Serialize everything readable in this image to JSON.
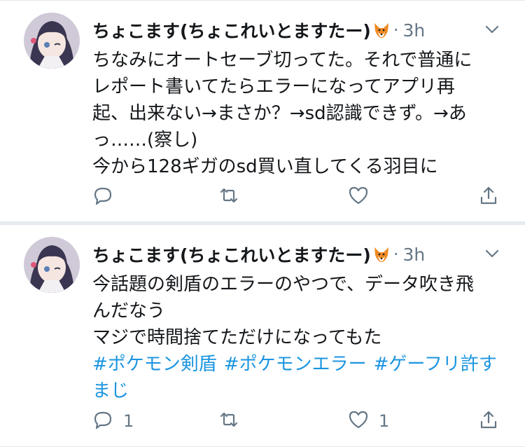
{
  "tweets": [
    {
      "author": "ちょこます(ちょこれいとますたー)",
      "separator": "·",
      "time": "3h",
      "lines": [
        "ちなみにオートセーブ切ってた。それで普通に",
        "レポート書いてたらエラーになってアプリ再",
        "起、出来ない→まさか？→sd認識できず。→あ",
        "っ……(察し)",
        "今から128ギガのsd買い直してくる羽目に"
      ],
      "hashtags": [],
      "hashtag_wrap": "",
      "reply_count": "",
      "retweet_count": "",
      "like_count": ""
    },
    {
      "author": "ちょこます(ちょこれいとますたー)",
      "separator": "·",
      "time": "3h",
      "lines": [
        "今話題の剣盾のエラーのやつで、データ吹き飛",
        "んだなう",
        "マジで時間捨てただけになってもた"
      ],
      "hashtags": [
        "#ポケモン剣盾",
        "#ポケモンエラー",
        "#ゲーフリ許す"
      ],
      "hashtag_wrap": "まじ",
      "reply_count": "1",
      "retweet_count": "",
      "like_count": "1"
    }
  ],
  "icons": [
    "fox-emoji-icon",
    "caret-down-icon",
    "reply-icon",
    "retweet-icon",
    "like-icon",
    "share-icon"
  ],
  "colors": {
    "link": "#1b95e0",
    "meta": "#657786",
    "text": "#14171a",
    "divider": "#e1e8ed",
    "background": "#e6ecf0"
  }
}
